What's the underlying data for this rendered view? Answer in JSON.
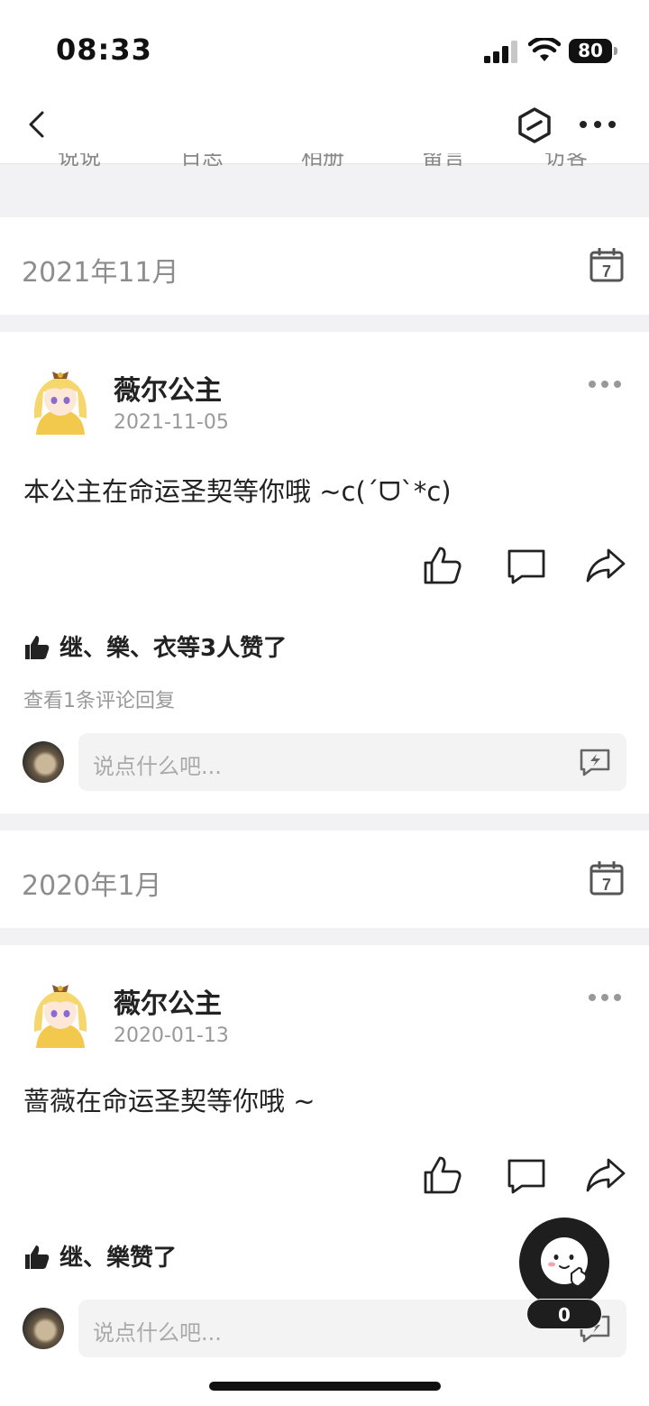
{
  "status_bar": {
    "time": "08:33",
    "battery": "80"
  },
  "nav": {
    "hidden_tabs": [
      "说说",
      "日志",
      "相册",
      "留言",
      "访客"
    ]
  },
  "sections": [
    {
      "month": "2021年11月",
      "calendar_day": "7",
      "post": {
        "author": "薇尔公主",
        "date": "2021-11-05",
        "text": "本公主在命运圣契等你哦 ~c(´ᗜ`*c)",
        "likes": "继、樂、衣等3人赞了",
        "view_comments": "查看1条评论回复",
        "comment_placeholder": "说点什么吧..."
      }
    },
    {
      "month": "2020年1月",
      "calendar_day": "7",
      "post": {
        "author": "薇尔公主",
        "date": "2020-01-13",
        "text": "蔷薇在命运圣契等你哦 ~",
        "likes": "继、樂赞了",
        "comment_placeholder": "说点什么吧..."
      }
    }
  ],
  "floating": {
    "count": "0"
  }
}
